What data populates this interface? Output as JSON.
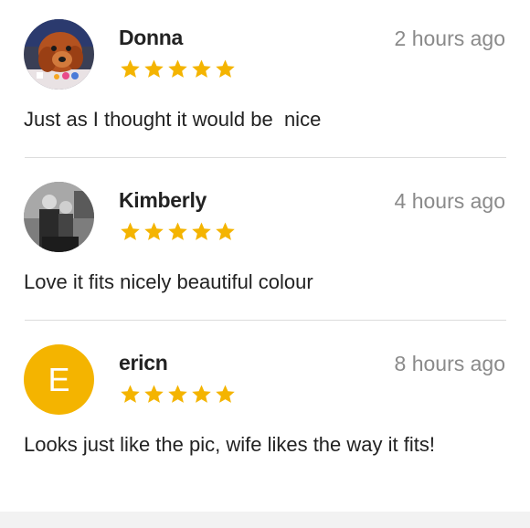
{
  "reviews": [
    {
      "name": "Donna",
      "time": "2 hours ago",
      "rating": 5,
      "text": "Just as I thought it would be  nice",
      "avatar": {
        "type": "photo",
        "icon": "dog-photo-avatar"
      }
    },
    {
      "name": "Kimberly",
      "time": "4 hours ago",
      "rating": 5,
      "text": "Love it fits nicely beautiful colour",
      "avatar": {
        "type": "photo",
        "icon": "couple-photo-avatar"
      }
    },
    {
      "name": "ericn",
      "time": "8 hours ago",
      "rating": 5,
      "text": "Looks just like the pic, wife likes the way it fits!",
      "avatar": {
        "type": "letter",
        "letter": "E",
        "color": "#f4b400"
      }
    }
  ],
  "colors": {
    "star": "#f4b400",
    "name": "#222222",
    "time": "#8a8a8a",
    "divider": "#dcdcdc"
  }
}
